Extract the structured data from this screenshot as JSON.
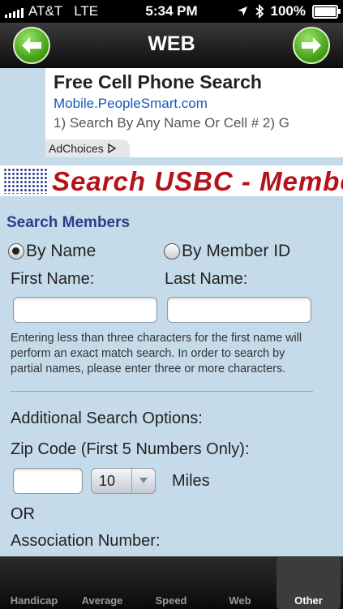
{
  "status": {
    "carrier": "AT&T",
    "network": "LTE",
    "time": "5:34 PM",
    "battery": "100%"
  },
  "nav": {
    "title": "WEB"
  },
  "ad": {
    "headline": "Free Cell Phone Search",
    "url": "Mobile.PeopleSmart.com",
    "text": "1) Search By Any Name Or Cell # 2) G",
    "adchoices": "AdChoices"
  },
  "banner": {
    "text": "Search USBC - Membe"
  },
  "form": {
    "title": "Search Members",
    "radio_name": "By Name",
    "radio_member_id": "By Member ID",
    "first_name_label": "First Name:",
    "last_name_label": "Last Name:",
    "first_name_value": "",
    "last_name_value": "",
    "note": "Entering less than three characters for the first name will perform an exact match search. In order to search by partial names, please enter three or more characters.",
    "additional_label": "Additional Search Options:",
    "zip_label": "Zip Code (First 5 Numbers Only):",
    "zip_value": "",
    "miles_selected": "10",
    "miles_label": "Miles",
    "or_label": "OR",
    "association_label": "Association Number:"
  },
  "tabs": [
    {
      "label": "Handicap",
      "active": false
    },
    {
      "label": "Average",
      "active": false
    },
    {
      "label": "Speed",
      "active": false
    },
    {
      "label": "Web",
      "active": false
    },
    {
      "label": "Other",
      "active": true
    }
  ],
  "colors": {
    "page_bg": "#c5dbe9",
    "title_blue": "#2a3d8c",
    "banner_red": "#b5121b",
    "nav_green": "#3e9b12"
  }
}
